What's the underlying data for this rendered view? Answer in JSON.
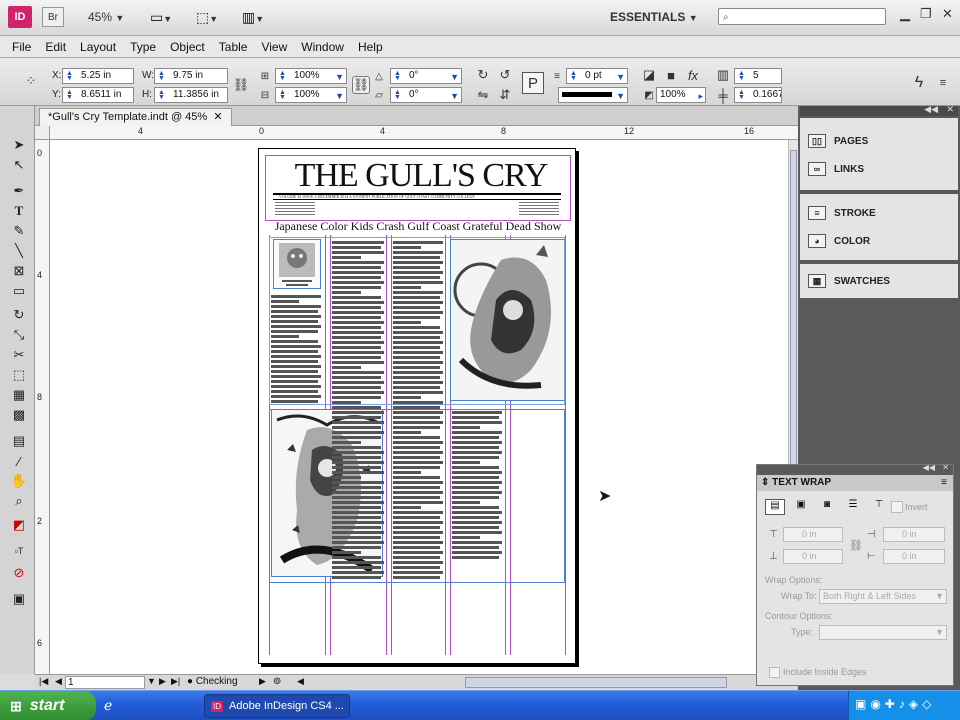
{
  "app": {
    "logo": "ID",
    "bridge": "Br",
    "zoom": "45%",
    "workspace": "ESSENTIALS",
    "search_placeholder": ""
  },
  "menu": [
    "File",
    "Edit",
    "Layout",
    "Type",
    "Object",
    "Table",
    "View",
    "Window",
    "Help"
  ],
  "control": {
    "x_label": "X:",
    "x_value": "5.25 in",
    "y_label": "Y:",
    "y_value": "8.6511 in",
    "w_label": "W:",
    "w_value": "9.75 in",
    "h_label": "H:",
    "h_value": "11.3856 in",
    "scale_x": "100%",
    "scale_y": "100%",
    "rotate": "0°",
    "shear": "0°",
    "stroke_weight": "0 pt",
    "opacity": "100%",
    "columns": "5",
    "gutter": "0.1667 i"
  },
  "document": {
    "tab_title": "*Gull's Cry Template.indt @ 45%",
    "masthead": "THE GULL'S CRY",
    "headline": "Japanese Color Kids Crash Gulf Coast Grateful Dead Show",
    "masthead_line": "VOLUME XI ISSUE 4          DECEMBER 2012          A STUDENT PUBLICATION OF GULF COAST COMMUNITY COLLEGE"
  },
  "ruler": {
    "h_ticks": [
      "4",
      "0",
      "4",
      "8",
      "12",
      "16"
    ],
    "v_ticks": [
      "0",
      "4",
      "8",
      "2",
      "6"
    ]
  },
  "status": {
    "page": "1",
    "preflight": "Checking"
  },
  "panels": {
    "dock": [
      "PAGES",
      "LINKS",
      "STROKE",
      "COLOR",
      "SWATCHES"
    ],
    "text_wrap": {
      "title": "TEXT WRAP",
      "invert": "Invert",
      "top_offset": "0 in",
      "bottom_offset": "0 in",
      "left_offset": "0 in",
      "right_offset": "0 in",
      "wrap_options": "Wrap Options:",
      "wrap_to_label": "Wrap To:",
      "wrap_to_value": "Both Right & Left Sides",
      "contour_options": "Contour Options:",
      "type_label": "Type:",
      "include_inside": "Include Inside Edges"
    }
  },
  "taskbar": {
    "start": "start",
    "task": "Adobe InDesign CS4 ..."
  },
  "colors": {
    "indesign_brand": "#d1236a",
    "guide": "#b050c8",
    "frame": "#4a82d0",
    "taskbar": "#245edb"
  }
}
